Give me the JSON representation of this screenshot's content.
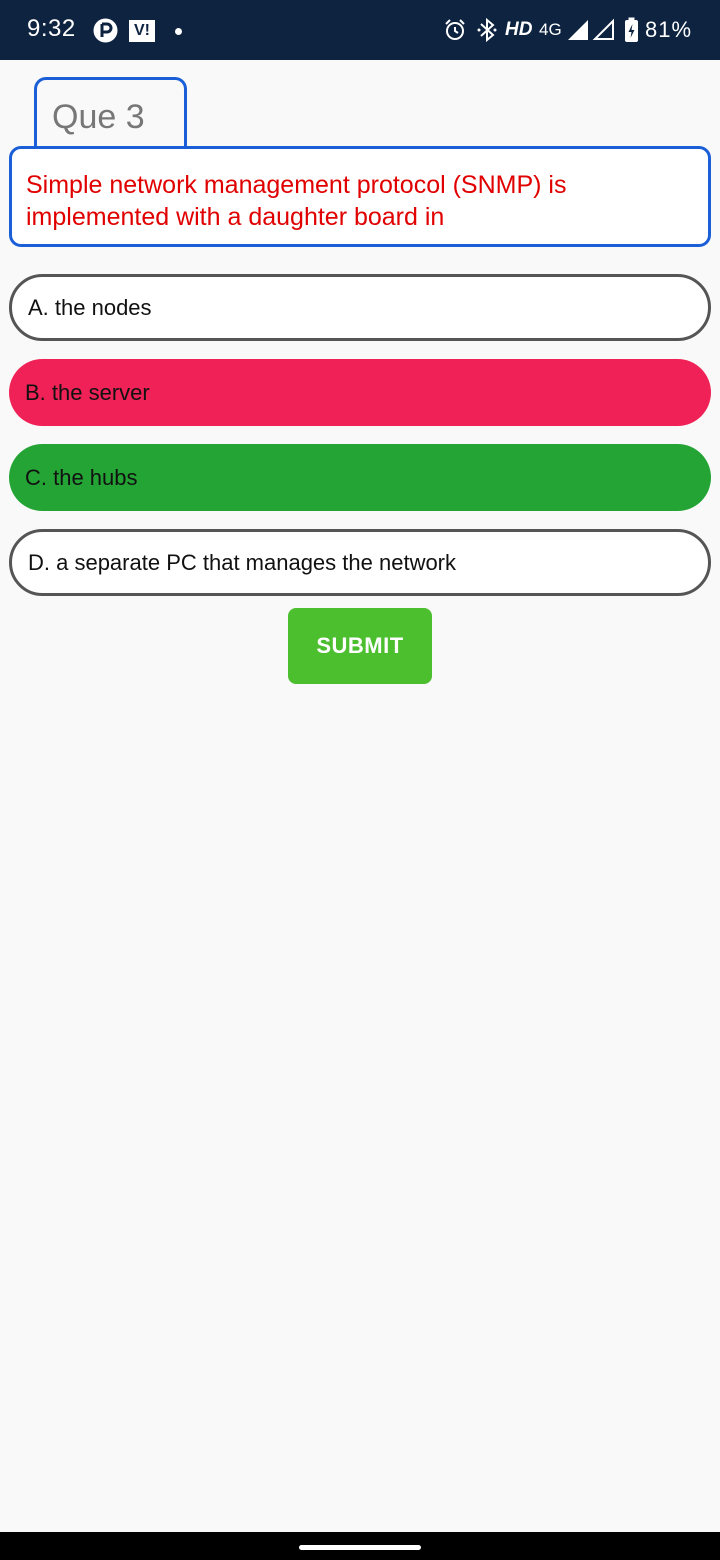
{
  "status_bar": {
    "time": "9:32",
    "carrier_badge": "VI",
    "hd_label": "HD",
    "network_label": "4G",
    "battery_percent": "81%",
    "icons": [
      "p-app-icon",
      "vi-icon",
      "dot-icon",
      "alarm-icon",
      "bluetooth-icon",
      "signal-icon",
      "signal-icon",
      "battery-charging-icon"
    ]
  },
  "quiz": {
    "question_number_label": "Que 3",
    "question_text": "Simple network management protocol (SNMP) is implemented with a daughter board in",
    "options": [
      {
        "label": "A. the nodes",
        "state": "default"
      },
      {
        "label": "B. the server",
        "state": "wrong"
      },
      {
        "label": "C. the hubs",
        "state": "correct"
      },
      {
        "label": "D. a separate PC that manages the network",
        "state": "default"
      }
    ],
    "submit_label": "SUBMIT"
  },
  "colors": {
    "status_bar_bg": "#0d2340",
    "accent_border": "#1a5fd8",
    "question_text": "#e00000",
    "wrong_option": "#ef2156",
    "correct_option": "#24a434",
    "submit_bg": "#4cbf2f"
  }
}
